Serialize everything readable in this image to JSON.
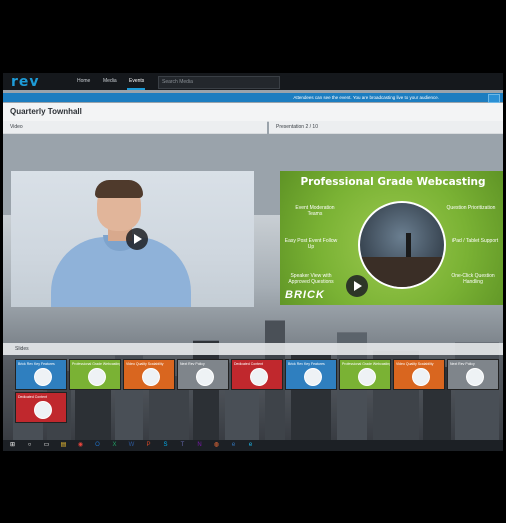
{
  "app": {
    "logo": "rev"
  },
  "nav": {
    "items": [
      "Home",
      "Media",
      "Events"
    ],
    "search_placeholder": "Search Media"
  },
  "banner": {
    "text": "Attendees can see the event. You are broadcasting live to your audience."
  },
  "page": {
    "title": "Quarterly Townhall"
  },
  "panels": {
    "video_label": "Video",
    "presentation_label": "Presentation 2 / 10",
    "slides_label": "Slides"
  },
  "slide": {
    "title": "Professional Grade Webcasting",
    "features": {
      "event_moderation": "Event Moderation Teams",
      "question_prioritization": "Question Prioritization",
      "easy_post_event": "Easy Post Event Follow Up",
      "ipad_support": "iPad / Tablet Support",
      "speaker_view": "Speaker View with Approved Questions",
      "one_click": "One-Click Question Handling"
    },
    "brand": "BRICK"
  },
  "thumbnails": [
    {
      "label": "Brick Rev Key Features",
      "color": "#2f7fbf"
    },
    {
      "label": "Professional Grade Webcasting",
      "color": "#7ab234"
    },
    {
      "label": "Video Quality Scalability",
      "color": "#d9661f"
    },
    {
      "label": "Next Rev Policy",
      "color": "#7f858b"
    },
    {
      "label": "Dedicated Content",
      "color": "#c0282d"
    },
    {
      "label": "Brick Rev Key Features",
      "color": "#2f7fbf"
    },
    {
      "label": "Professional Grade Webcasting",
      "color": "#7ab234"
    },
    {
      "label": "Video Quality Scalability",
      "color": "#d9661f"
    },
    {
      "label": "Next Rev Policy",
      "color": "#7f858b"
    },
    {
      "label": "Dedicated Content",
      "color": "#c0282d"
    }
  ],
  "taskbar": {
    "icons": [
      "windows-icon",
      "search-icon",
      "task-view-icon",
      "file-explorer-icon",
      "chrome-icon",
      "outlook-icon",
      "excel-icon",
      "word-icon",
      "powerpoint-icon",
      "skype-icon",
      "teams-icon",
      "onenote-icon",
      "firefox-icon",
      "edge-icon",
      "ie-icon"
    ]
  }
}
